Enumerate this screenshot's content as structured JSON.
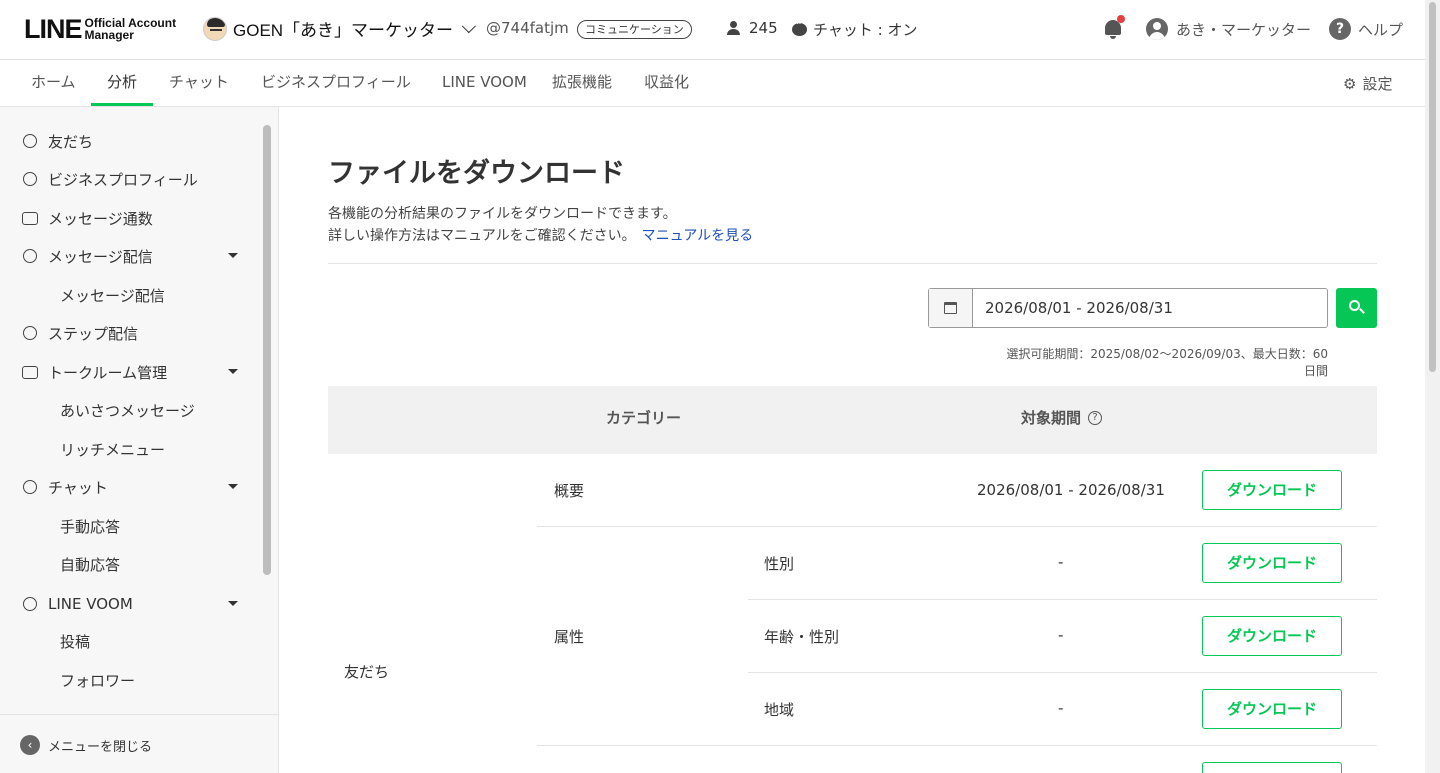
{
  "header": {
    "logo_main": "LINE",
    "logo_sub_line1": "Official Account",
    "logo_sub_line2": "Manager",
    "account_name": "GOEN「あき」マーケッター",
    "account_id": "@744fatjm",
    "plan_badge": "コミュニケーション",
    "friend_count": "245",
    "chat_status": "チャット : オン",
    "user_name": "あき・マーケッター",
    "help_label": "ヘルプ"
  },
  "nav": {
    "tabs": [
      {
        "label": "ホーム"
      },
      {
        "label": "分析"
      },
      {
        "label": "チャット"
      },
      {
        "label": "ビジネスプロフィール"
      },
      {
        "label": "LINE VOOM"
      },
      {
        "label": "拡張機能"
      },
      {
        "label": "収益化"
      }
    ],
    "active_tab": "分析",
    "settings_label": "設定"
  },
  "sidebar": {
    "items": [
      {
        "label": "友だち",
        "icon": "add-friend-icon"
      },
      {
        "label": "ビジネスプロフィール",
        "icon": "profile-icon"
      },
      {
        "label": "メッセージ通数",
        "icon": "inbox-icon"
      },
      {
        "label": "メッセージ配信",
        "icon": "broadcast-icon"
      },
      {
        "label": "メッセージ配信"
      },
      {
        "label": "ステップ配信",
        "icon": "step-icon"
      },
      {
        "label": "トークルーム管理",
        "icon": "talkroom-icon"
      },
      {
        "label": "あいさつメッセージ"
      },
      {
        "label": "リッチメニュー"
      },
      {
        "label": "チャット",
        "icon": "chat-icon"
      },
      {
        "label": "手動応答"
      },
      {
        "label": "自動応答"
      },
      {
        "label": "LINE VOOM",
        "icon": "voom-icon"
      },
      {
        "label": "投稿"
      },
      {
        "label": "フォロワー"
      }
    ],
    "close_menu_label": "メニューを閉じる"
  },
  "main": {
    "title": "ファイルをダウンロード",
    "description_line1": "各機能の分析結果のファイルをダウンロードできます。",
    "description_line2": "詳しい操作方法はマニュアルをご確認ください。",
    "manual_link": "マニュアルを見る",
    "date_range_value": "2026/08/01 - 2026/08/31",
    "range_note": "選択可能期間：2025/08/02〜2026/09/03、最大日数：60日間",
    "table": {
      "header_category": "カテゴリー",
      "header_period": "対象期間",
      "group_label": "友だち",
      "rows": [
        {
          "category": "概要",
          "sub": "",
          "period": "2026/08/01 - 2026/08/31",
          "action": "ダウンロード"
        },
        {
          "category": "属性",
          "sub": "性別",
          "period": "-",
          "action": "ダウンロード"
        },
        {
          "category": "",
          "sub": "年齢・性別",
          "period": "-",
          "action": "ダウンロード"
        },
        {
          "category": "",
          "sub": "地域",
          "period": "-",
          "action": "ダウンロード"
        }
      ]
    }
  },
  "colors": {
    "accent_green": "#06c755",
    "link_blue": "#1f4fb8",
    "notification_red": "#e53e3e"
  }
}
